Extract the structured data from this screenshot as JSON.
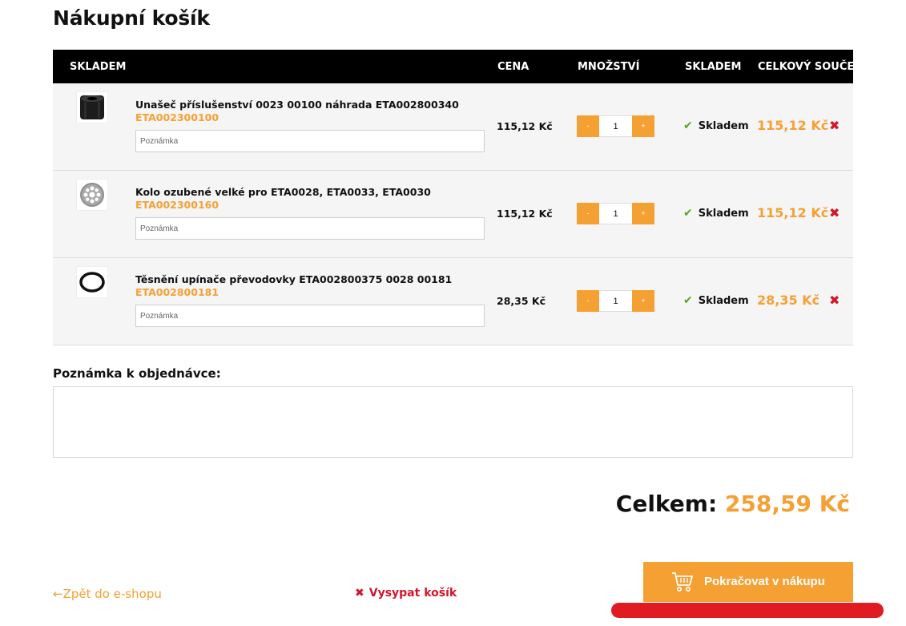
{
  "title": "Nákupní košík",
  "table": {
    "headers": {
      "product": "SKLADEM",
      "price": "CENA",
      "quantity": "MNOŽSTVÍ",
      "stock": "SKLADEM",
      "total": "CELKOVÝ SOUČET"
    },
    "note_placeholder": "Poznámka",
    "qty_minus": "-",
    "qty_plus": "+",
    "rows": [
      {
        "name": "Unašeč příslušenství 0023 00100 náhrada ETA002800340",
        "code": "ETA002300100",
        "price": "115,12 Kč",
        "qty": "1",
        "stock": "Skladem",
        "total": "115,12 Kč",
        "icon": "sleeve-part-icon"
      },
      {
        "name": "Kolo ozubené velké pro ETA0028, ETA0033, ETA0030",
        "code": "ETA002300160",
        "price": "115,12 Kč",
        "qty": "1",
        "stock": "Skladem",
        "total": "115,12 Kč",
        "icon": "gear-wheel-icon"
      },
      {
        "name": "Těsnění upínače převodovky ETA002800375 0028 00181",
        "code": "ETA002800181",
        "price": "28,35 Kč",
        "qty": "1",
        "stock": "Skladem",
        "total": "28,35 Kč",
        "icon": "o-ring-icon"
      }
    ]
  },
  "order_note": {
    "label": "Poznámka k objednávce:"
  },
  "summary": {
    "label": "Celkem:",
    "value": "258,59 Kč"
  },
  "footer": {
    "back_label": "Zpět do e-shopu",
    "back_icon": "←",
    "empty_label": "Vysypat košík",
    "continue_label": "Pokračovat v nákupu"
  },
  "colors": {
    "accent": "#f5a033",
    "danger": "#d4142a",
    "success": "#5aa51b",
    "header_bg": "#000000",
    "row_bg": "#f5f5f5"
  }
}
